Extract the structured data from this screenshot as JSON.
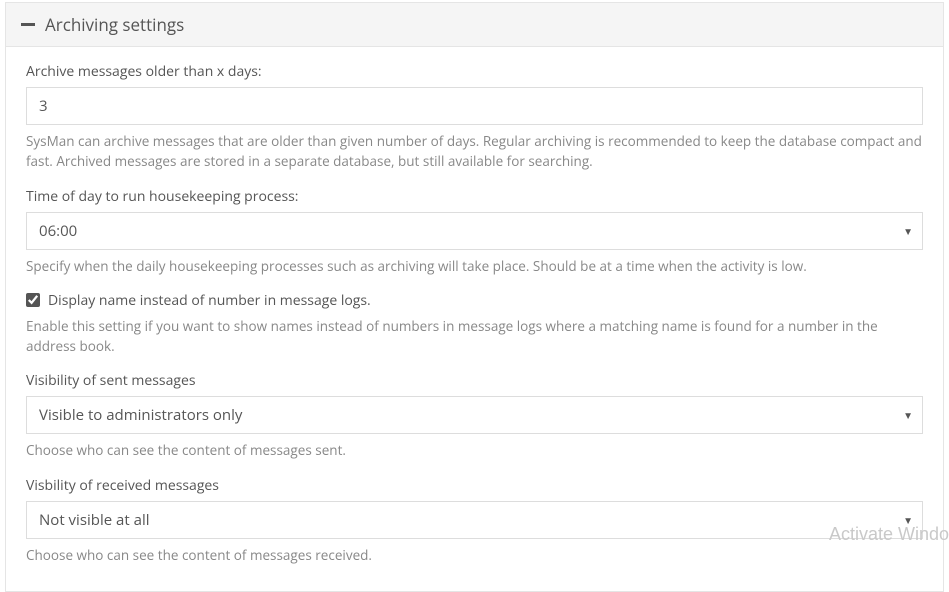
{
  "panel": {
    "title": "Archiving settings"
  },
  "archive_days": {
    "label": "Archive messages older than x days:",
    "value": "3",
    "help": "SysMan can archive messages that are older than given number of days. Regular archiving is recommended to keep the database compact and fast. Archived messages are stored in a separate database, but still available for searching."
  },
  "housekeeping_time": {
    "label": "Time of day to run housekeeping process:",
    "value": "06:00",
    "help": "Specify when the daily housekeeping processes such as archiving will take place. Should be at a time when the activity is low."
  },
  "display_name": {
    "label": "Display name instead of number in message logs.",
    "checked": true,
    "help": "Enable this setting if you want to show names instead of numbers in message logs where a matching name is found for a number in the address book."
  },
  "visibility_sent": {
    "label": "Visibility of sent messages",
    "value": "Visible to administrators only",
    "help": "Choose who can see the content of messages sent."
  },
  "visibility_received": {
    "label": "Visbility of received messages",
    "value": "Not visible at all",
    "help": "Choose who can see the content of messages received."
  },
  "watermark": "Activate Windo"
}
